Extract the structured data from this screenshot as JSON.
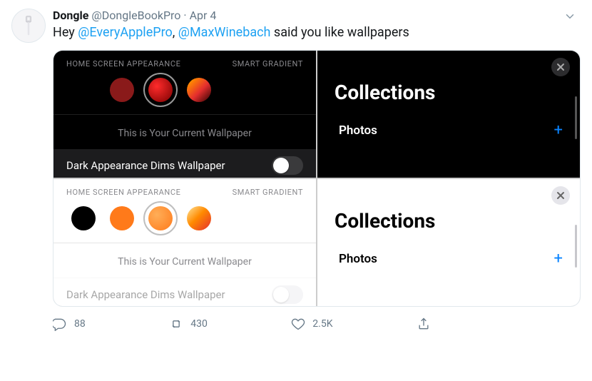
{
  "tweet": {
    "display_name": "Dongle",
    "handle": "@DongleBookPro",
    "separator": "·",
    "date": "Apr 4",
    "text_parts": {
      "p1": "Hey ",
      "m1": "@EveryApplePro",
      "p2": ", ",
      "m2": "@MaxWinebach",
      "p3": " said you like wallpapers"
    }
  },
  "panes": {
    "dark_settings": {
      "home_screen_label": "HOME SCREEN APPEARANCE",
      "smart_gradient_label": "SMART GRADIENT",
      "swatches": [
        {
          "bg": "#000000"
        },
        {
          "bg": "#8a1a1a"
        },
        {
          "bg": "radial-gradient(circle at 35% 35%, #ff2b2b, #7a0000)",
          "selected": true
        },
        {
          "bg": "linear-gradient(135deg, #ff8a00 15%, #e52e2e 55%, #2b0000 100%)"
        }
      ],
      "current_wallpaper": "This is Your Current Wallpaper",
      "dark_dims_label": "Dark Appearance Dims Wallpaper"
    },
    "light_settings": {
      "home_screen_label": "HOME SCREEN APPEARANCE",
      "smart_gradient_label": "SMART GRADIENT",
      "swatches": [
        {
          "bg": "#000000"
        },
        {
          "bg": "#ff7a1a"
        },
        {
          "bg": "radial-gradient(circle at 35% 35%, #ffae58, #ff7a1a)",
          "selected": true
        },
        {
          "bg": "linear-gradient(135deg, #ffd27a 10%, #ff8a00 45%, #e52e2e 100%)"
        }
      ],
      "current_wallpaper": "This is Your Current Wallpaper",
      "dark_dims_label": "Dark Appearance Dims Wallpaper"
    },
    "dark_collections": {
      "title": "Collections",
      "photos_label": "Photos",
      "add_glyph": "+"
    },
    "light_collections": {
      "title": "Collections",
      "photos_label": "Photos",
      "add_glyph": "+"
    }
  },
  "actions": {
    "reply_count": "88",
    "retweet_count": "430",
    "like_count": "2.5K"
  }
}
